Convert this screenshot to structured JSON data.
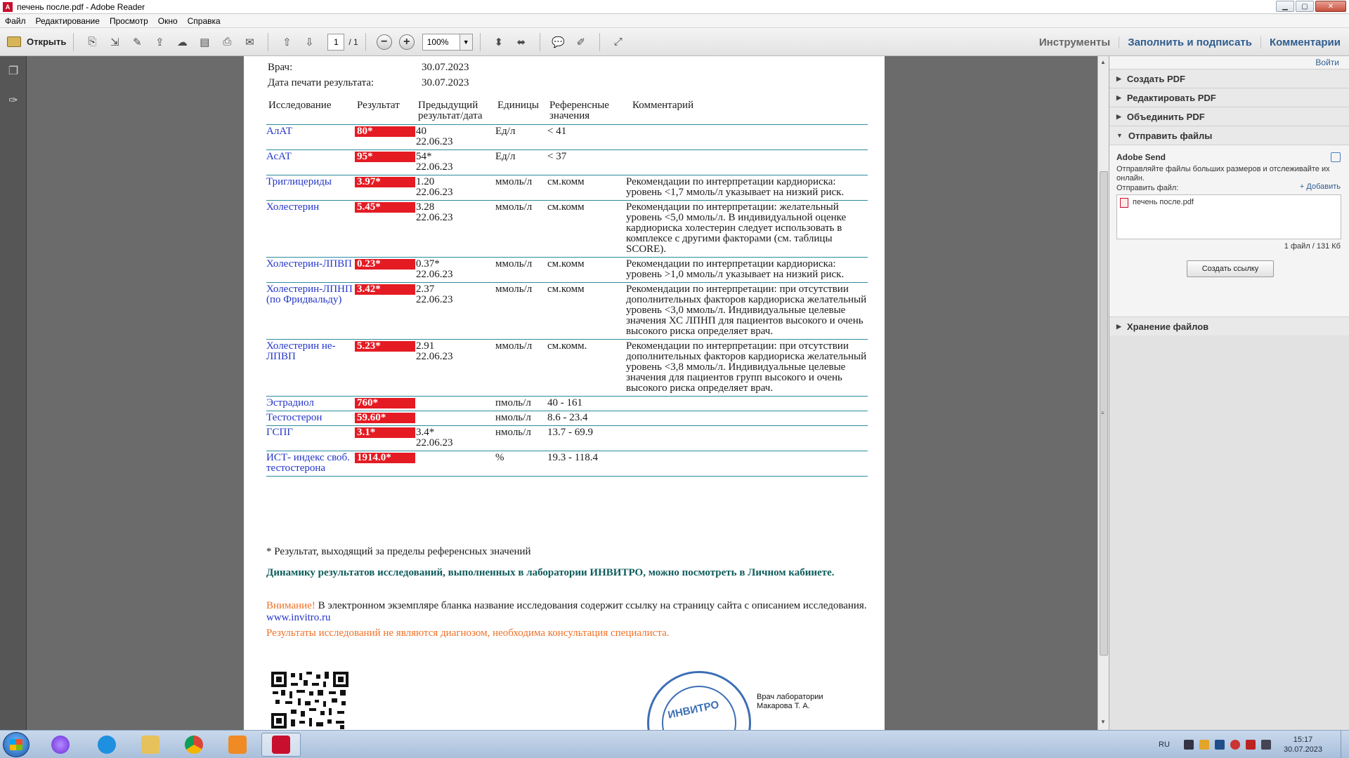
{
  "window": {
    "title": "печень после.pdf - Adobe Reader"
  },
  "menu": [
    "Файл",
    "Редактирование",
    "Просмотр",
    "Окно",
    "Справка"
  ],
  "toolbar": {
    "open_label": "Открыть",
    "page_current": "1",
    "page_total": "/ 1",
    "zoom": "100%",
    "tools_label": "Инструменты",
    "fill_sign_label": "Заполнить и подписать",
    "comments_label": "Комментарии"
  },
  "document": {
    "meta": [
      {
        "key": "Врач:",
        "value": "30.07.2023"
      },
      {
        "key": "Дата печати результата:",
        "value": "30.07.2023"
      }
    ],
    "headers": {
      "test": "Исследование",
      "result": "Результат",
      "prev": "Предыдущий результат/дата",
      "units": "Единицы",
      "ref": "Референсные значения",
      "comment": "Комментарий"
    },
    "rows": [
      {
        "name": "АлАТ",
        "result": "80*",
        "prev": "40",
        "prev_date": "22.06.23",
        "units": "Ед/л",
        "ref": "< 41",
        "comment": ""
      },
      {
        "name": "АсАТ",
        "result": "95*",
        "prev": "54*",
        "prev_date": "22.06.23",
        "units": "Ед/л",
        "ref": "< 37",
        "comment": ""
      },
      {
        "name": "Триглицериды",
        "result": "3.97*",
        "prev": "1.20",
        "prev_date": "22.06.23",
        "units": "ммоль/л",
        "ref": "см.комм",
        "comment": "Рекомендации по интерпретации кардиориска: уровень <1,7 ммоль/л указывает на низкий риск."
      },
      {
        "name": "Холестерин",
        "result": "5.45*",
        "prev": "3.28",
        "prev_date": "22.06.23",
        "units": "ммоль/л",
        "ref": "см.комм",
        "comment": "Рекомендации по интерпретации: желательный уровень <5,0 ммоль/л. В индивидуальной оценке кардиориска холестерин следует использовать в комплексе с другими факторами (см. таблицы SCORE)."
      },
      {
        "name": "Холестерин-ЛПВП",
        "result": "0.23*",
        "prev": "0.37*",
        "prev_date": "22.06.23",
        "units": "ммоль/л",
        "ref": "см.комм",
        "comment": "Рекомендации по интерпретации кардиориска: уровень >1,0 ммоль/л указывает на низкий риск."
      },
      {
        "name": "Холестерин-ЛПНП (по Фридвальду)",
        "result": "3.42*",
        "prev": "2.37",
        "prev_date": "22.06.23",
        "units": "ммоль/л",
        "ref": "см.комм",
        "comment": "Рекомендации по интерпретации: при отсутствии дополнительных факторов кардиориска желательный уровень <3,0 ммоль/л. Индивидуальные целевые значения ХС ЛПНП для пациентов высокого и очень высокого риска определяет врач."
      },
      {
        "name": "Холестерин не-ЛПВП",
        "result": "5.23*",
        "prev": "2.91",
        "prev_date": "22.06.23",
        "units": "ммоль/л",
        "ref": "см.комм.",
        "comment": "Рекомендации по интерпретации: при отсутствии дополнительных факторов кардиориска желательный уровень <3,8 ммоль/л. Индивидуальные целевые значения для пациентов групп высокого и очень высокого риска определяет врач."
      },
      {
        "name": "Эстрадиол",
        "result": "760*",
        "prev": "",
        "prev_date": "",
        "units": "пмоль/л",
        "ref": "40 - 161",
        "comment": ""
      },
      {
        "name": "Тестостерон",
        "result": "59.60*",
        "prev": "",
        "prev_date": "",
        "units": "нмоль/л",
        "ref": "8.6 - 23.4",
        "comment": ""
      },
      {
        "name": "ГСПГ",
        "result": "3.1*",
        "prev": "3.4*",
        "prev_date": "22.06.23",
        "units": "нмоль/л",
        "ref": "13.7 - 69.9",
        "comment": ""
      },
      {
        "name": "ИСТ- индекс своб. тестостерона",
        "result": "1914.0*",
        "prev": "",
        "prev_date": "",
        "units": "%",
        "ref": "19.3 - 118.4",
        "comment": ""
      }
    ],
    "footnote": "* Результат, выходящий за пределы референсных значений",
    "dynamics": "Динамику результатов исследований, выполненных в лаборатории ИНВИТРО, можно посмотреть в Личном кабинете.",
    "attention_label": "Внимание!",
    "attention_text": " В электронном экземпляре бланка название исследования содержит ссылку на страницу сайта с описанием исследования. ",
    "site_link": "www.invitro.ru",
    "diagnosis_note": "Результаты исследований не являются диагнозом, необходима консультация специалиста.",
    "stamp_text": "ИНВИТРО",
    "doctor_title": "Врач лаборатории",
    "doctor_name": "Макарова Т. А."
  },
  "right_pane": {
    "login": "Войти",
    "sections": [
      "Создать PDF",
      "Редактировать PDF",
      "Объединить PDF",
      "Отправить файлы"
    ],
    "send": {
      "title": "Adobe Send",
      "description": "Отправляйте файлы больших размеров и отслеживайте их онлайн.",
      "send_label": "Отправить файл:",
      "add_link": "+ Добавить",
      "file_name": "печень после.pdf",
      "file_size": "1 файл / 131 Кб",
      "create_link_button": "Создать ссылку"
    },
    "storage": "Хранение файлов"
  },
  "taskbar": {
    "lang": "RU",
    "time": "15:17",
    "date": "30.07.2023"
  },
  "colors": {
    "result_highlight": "#e41b23",
    "link_blue": "#2335c8",
    "table_rule": "#2a8c9e",
    "warning_orange": "#f07025",
    "dynamics_teal": "#0f5c5c"
  }
}
